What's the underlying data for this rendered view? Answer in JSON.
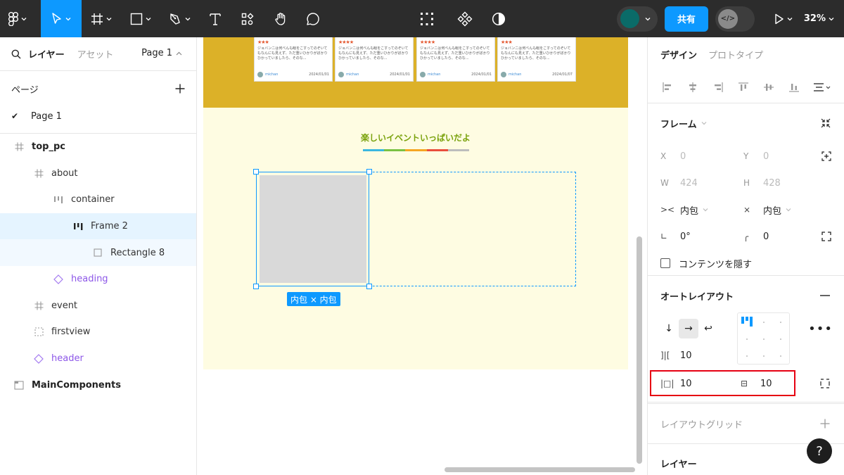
{
  "toolbar": {
    "share_label": "共有",
    "zoom_label": "32%"
  },
  "left_panel": {
    "tab_layers": "レイヤー",
    "tab_assets": "アセット",
    "page_selector": "Page 1",
    "pages_heading": "ページ",
    "pages": [
      {
        "label": "Page 1"
      }
    ],
    "layers": [
      {
        "label": "top_pc"
      },
      {
        "label": "about"
      },
      {
        "label": "container"
      },
      {
        "label": "Frame 2"
      },
      {
        "label": "Rectangle 8"
      },
      {
        "label": "heading"
      },
      {
        "label": "event"
      },
      {
        "label": "firstview"
      },
      {
        "label": "header"
      },
      {
        "label": "MainComponents"
      }
    ]
  },
  "canvas": {
    "review_cards": [
      {
        "stars": "★★★",
        "text": "ジョバンニは何べんも眼をこすってのぞいてもなんにも見えず、ただ重いひかりがぼかりひかっていましたら、そのな...",
        "name": "michan",
        "date": "2024/01/01"
      },
      {
        "stars": "★★★★",
        "text": "ジョバンニは何べんも眼をこすってのぞいてもなんにも見えず、ただ重いひかりがぼかりひかっていましたら、そのな...",
        "name": "michan",
        "date": "2024/01/01"
      },
      {
        "stars": "★★★★",
        "text": "ジョバンニは何べんも眼をこすってのぞいてもなんにも見えず、ただ重いひかりがぼかりひかっていましたら、そのな...",
        "name": "michan",
        "date": "2024/01/01"
      },
      {
        "stars": "★★★",
        "text": "ジョバンニは何べんも眼をこすってのぞいてもなんにも見えず、ただ重いひかりがぼかりひかっていましたら、そのな...",
        "name": "michan",
        "date": "2024/01/07"
      }
    ],
    "event_heading": "楽しいイベントいっぱいだよ",
    "heading_bar_colors": [
      "#3bb7e0",
      "#7ac143",
      "#f6a623",
      "#e94e3c",
      "#bdbdbd"
    ],
    "size_badge": "内包 × 内包"
  },
  "right_panel": {
    "tab_design": "デザイン",
    "tab_prototype": "プロトタイプ",
    "frame_title": "フレーム",
    "x_label": "X",
    "x_value": "0",
    "y_label": "Y",
    "y_value": "0",
    "w_label": "W",
    "w_value": "424",
    "h_label": "H",
    "h_value": "428",
    "width_mode": "内包",
    "height_mode": "内包",
    "rotation": "0°",
    "corner_radius": "0",
    "clip_content_label": "コンテンツを隠す",
    "autolayout_title": "オートレイアウト",
    "gap_value": "10",
    "padding_horizontal": "10",
    "padding_vertical": "10",
    "layout_grid_title": "レイアウトグリッド",
    "layer_title": "レイヤー",
    "help_label": "?"
  },
  "colors": {
    "accent": "#0d99ff",
    "toolbar_bg": "#2c2c2c",
    "highlight_box": "#e60012",
    "board_yellow": "#dcb128",
    "board_cream": "#fefce2"
  }
}
